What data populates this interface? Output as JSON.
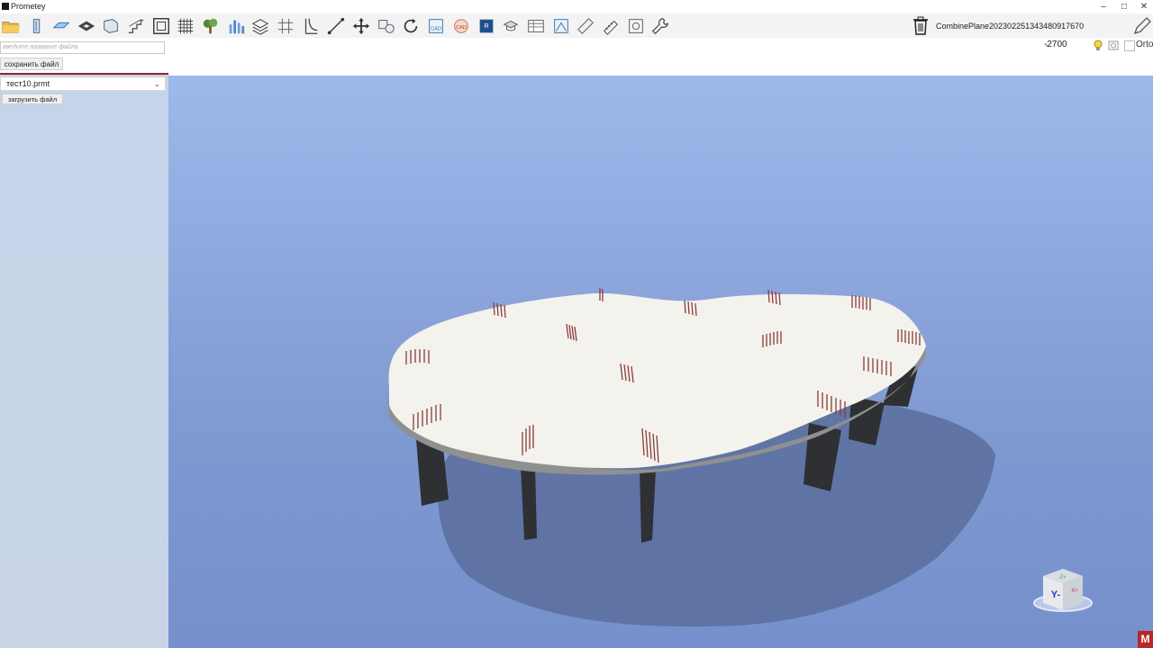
{
  "window": {
    "title": "Prometey",
    "minimize": "–",
    "maximize": "□",
    "close": "✕"
  },
  "toolbar": {
    "tools": [
      "open-folder-icon",
      "column-icon",
      "slab-icon",
      "opening-icon",
      "wall-icon",
      "stair-icon",
      "frame-icon",
      "grid-icon",
      "tree-icon",
      "chart-icon",
      "layers-icon",
      "axes-grid-icon",
      "beam-icon",
      "measure-icon",
      "move-icon",
      "copy-icon",
      "rotate-icon",
      "cad-import-icon",
      "cad-export-icon",
      "rvt-icon",
      "cap-icon",
      "table-icon",
      "drawing-icon",
      "ruler-icon",
      "rebar-icon",
      "group-icon",
      "settings-wrench-icon"
    ],
    "current_object": "CombinePlane20230225134348091​7670"
  },
  "view_controls": {
    "level": "-2700",
    "orto_label": "Orto"
  },
  "left_panel": {
    "filename_placeholder": "введите название файла",
    "save_label": "сохранить файл",
    "selected_file": "тест10.prmt",
    "load_label": "загрузить файл"
  },
  "view_cube": {
    "axis_label": "Y-",
    "top_label": "Z+",
    "side_label": "X+"
  },
  "corner_badge": "M",
  "colors": {
    "sky_top": "#9db9ea",
    "slab": "#f4f2ec",
    "column": "#2e3034",
    "rebar": "#8a3b3b",
    "shadow": "#596d9c"
  }
}
